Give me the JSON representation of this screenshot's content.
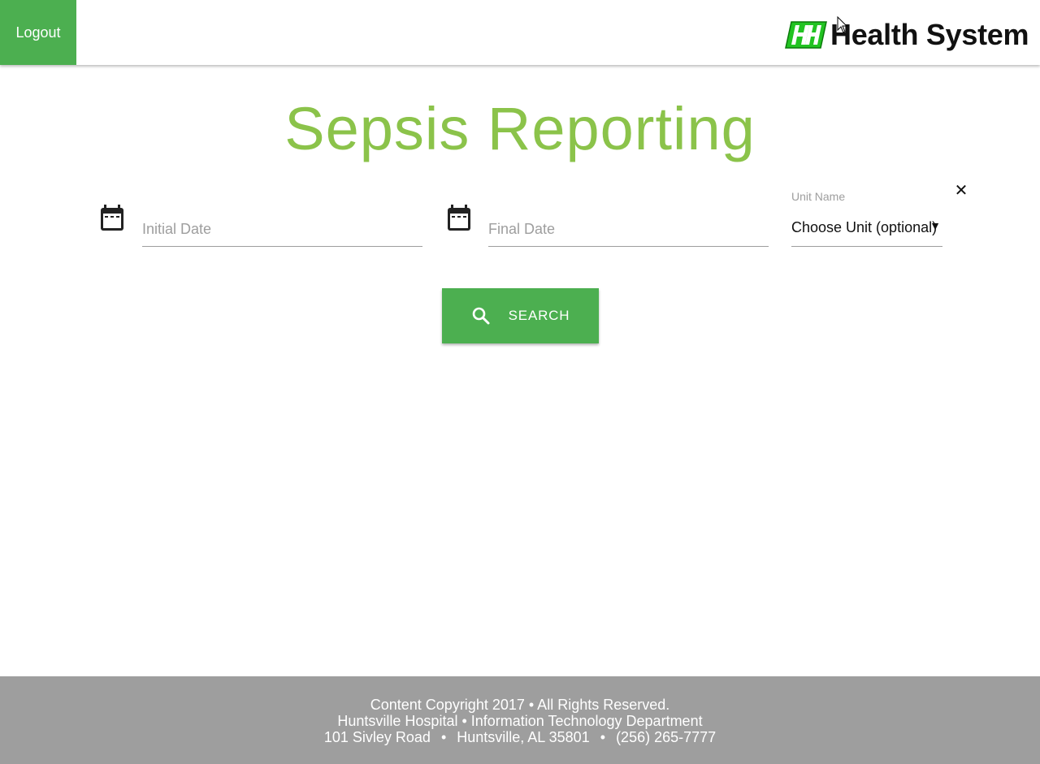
{
  "header": {
    "logout_label": "Logout",
    "logo_text": "Health System",
    "logo_mark": "HH"
  },
  "main": {
    "title": "Sepsis Reporting",
    "initial_date": {
      "placeholder": "Initial Date",
      "value": ""
    },
    "final_date": {
      "placeholder": "Final Date",
      "value": ""
    },
    "unit": {
      "label": "Unit Name",
      "selected": "Choose Unit (optional)",
      "clear_icon": "close-icon"
    },
    "search_label": "SEARCH"
  },
  "footer": {
    "line1": "Content Copyright 2017 • All Rights Reserved.",
    "line2": "Huntsville Hospital • Information Technology Department",
    "address": "101 Sivley Road",
    "city": "Huntsville, AL 35801",
    "phone": "(256) 265-7777",
    "separator": "•"
  },
  "colors": {
    "brand_green": "#4caf50",
    "title_green": "#8bc34a",
    "footer_gray": "#9e9e9e"
  }
}
